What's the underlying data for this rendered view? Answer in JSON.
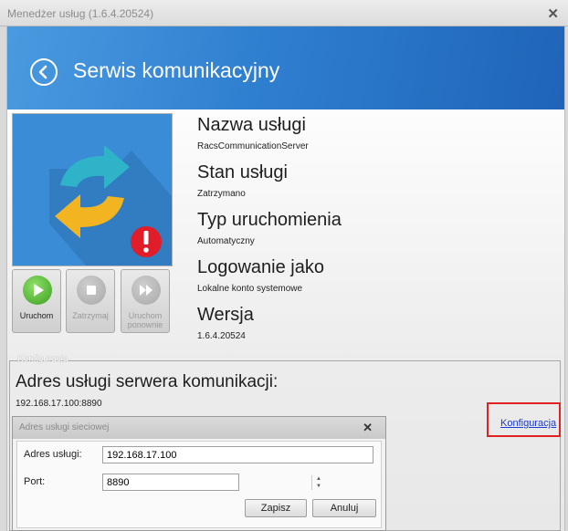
{
  "window": {
    "title": "Menedżer usług (1.6.4.20524)",
    "close_glyph": "✕"
  },
  "header": {
    "title": "Serwis komunikacyjny",
    "back_icon": "chevron-left-icon",
    "gradient": [
      "#4a9ae0",
      "#1f64b8"
    ]
  },
  "actions": [
    {
      "label": "Uruchom",
      "icon": "play-icon",
      "enabled": true
    },
    {
      "label": "Zatrzymaj",
      "icon": "stop-icon",
      "enabled": false
    },
    {
      "label": "Uruchom ponownie",
      "icon": "restart-icon",
      "enabled": false
    }
  ],
  "properties": {
    "service_name": {
      "label": "Nazwa usługi",
      "value": "RacsCommunicationServer"
    },
    "service_state": {
      "label": "Stan usługi",
      "value": "Zatrzymano"
    },
    "startup_type": {
      "label": "Typ uruchomienia",
      "value": "Automatyczny"
    },
    "logon_as": {
      "label": "Logowanie jako",
      "value": "Lokalne konto systemowe"
    },
    "version": {
      "label": "Wersja",
      "value": "1.6.4.20524"
    }
  },
  "config": {
    "group_label": "Konfiguracja",
    "address_title": "Adres usługi serwera komunikacji:",
    "address_value": "192.168.17.100:8890",
    "link_label": "Konfiguracja",
    "highlight_color": "#e02222"
  },
  "dialog": {
    "title": "Adres usługi sieciowej",
    "close_glyph": "✕",
    "address_label": "Adres usługi:",
    "address_value": "192.168.17.100",
    "port_label": "Port:",
    "port_value": "8890",
    "save_label": "Zapisz",
    "cancel_label": "Anuluj"
  },
  "icons": {
    "service_tile": "sync-arrows-icon",
    "warning": "exclamation-icon"
  }
}
